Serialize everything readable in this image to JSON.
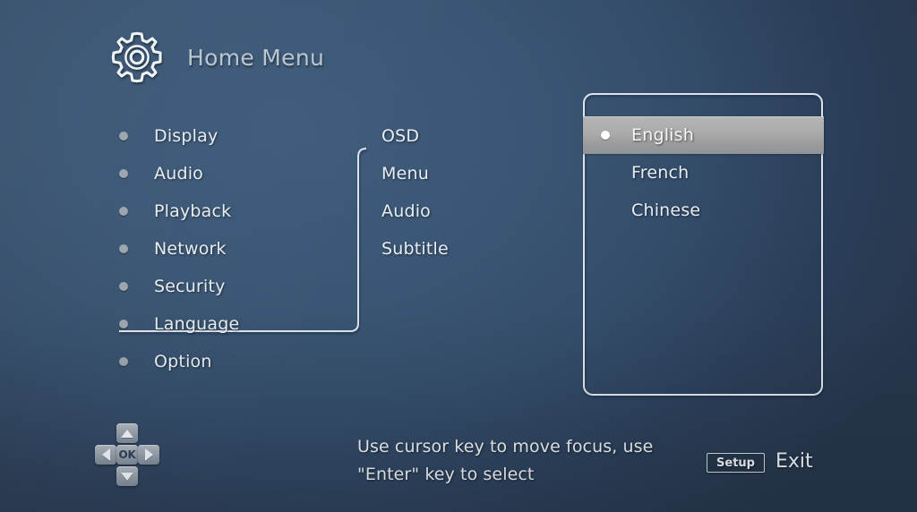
{
  "header": {
    "icon": "gear-icon",
    "title": "Home Menu"
  },
  "colors": {
    "background": "#3a5674",
    "background_dark": "#26364c",
    "text": "#e7edf2",
    "title_text": "#b9c5cf",
    "bullet": "#9aa4ae",
    "border": "#d8e2ea",
    "highlight_top": "#b5b5b5",
    "highlight_bottom": "#8f9398"
  },
  "menu_column_1": {
    "name": "settings-categories",
    "items": [
      {
        "label": "Display",
        "selected": false
      },
      {
        "label": "Audio",
        "selected": false
      },
      {
        "label": "Playback",
        "selected": false
      },
      {
        "label": "Network",
        "selected": false
      },
      {
        "label": "Security",
        "selected": false
      },
      {
        "label": "Language",
        "selected": true
      },
      {
        "label": "Option",
        "selected": false
      }
    ]
  },
  "menu_column_2": {
    "name": "language-subcategories",
    "items": [
      {
        "label": "OSD",
        "selected": true
      },
      {
        "label": "Menu",
        "selected": false
      },
      {
        "label": "Audio",
        "selected": false
      },
      {
        "label": "Subtitle",
        "selected": false
      }
    ]
  },
  "menu_column_3": {
    "name": "osd-language-options",
    "items": [
      {
        "label": "English",
        "selected": true
      },
      {
        "label": "French",
        "selected": false
      },
      {
        "label": "Chinese",
        "selected": false
      }
    ]
  },
  "dpad": {
    "up": "up-arrow",
    "down": "down-arrow",
    "left": "left-arrow",
    "right": "right-arrow",
    "center_label": "OK"
  },
  "footer": {
    "hint_line_1": "Use cursor key to move focus, use",
    "hint_line_2": "\"Enter\" key to select",
    "setup_label": "Setup",
    "exit_label": "Exit"
  }
}
